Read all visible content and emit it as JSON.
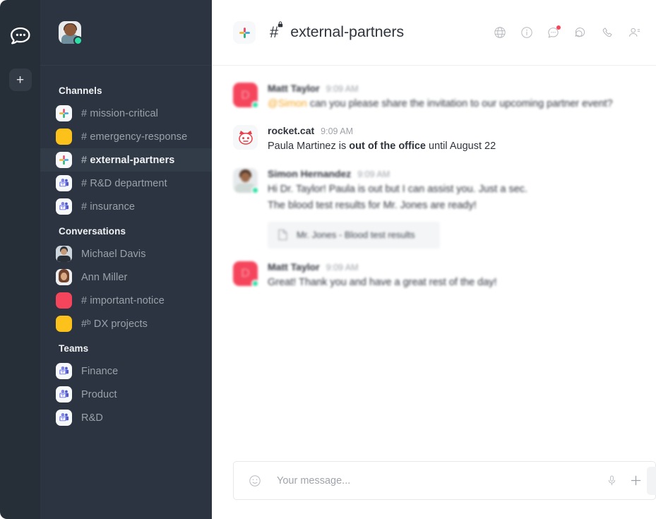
{
  "app": {
    "name": "Rocket.Chat",
    "rail": {
      "logo_icon": "rocket-chat-logo-icon",
      "add_label": "+"
    }
  },
  "sidebar": {
    "user_avatar": {
      "name": "current-user-avatar",
      "status": "online"
    },
    "sections": [
      {
        "title": "Channels",
        "items": [
          {
            "icon": "slack-icon",
            "prefix": "#",
            "label": "mission-critical",
            "active": false
          },
          {
            "icon": "color-swatch-yellow-icon",
            "prefix": "#",
            "label": "emergency-response",
            "active": false
          },
          {
            "icon": "slack-icon",
            "prefix": "#",
            "label": "external-partners",
            "active": true
          },
          {
            "icon": "microsoft-teams-icon",
            "prefix": "#",
            "label": "R&D department",
            "active": false
          },
          {
            "icon": "microsoft-teams-icon",
            "prefix": "#",
            "label": "insurance",
            "active": false
          }
        ]
      },
      {
        "title": "Conversations",
        "items": [
          {
            "icon": "user-avatar-male-icon",
            "prefix": "",
            "label": "Michael Davis",
            "active": false
          },
          {
            "icon": "user-avatar-female-icon",
            "prefix": "",
            "label": "Ann Miller",
            "active": false
          },
          {
            "icon": "color-swatch-red-icon",
            "prefix": "#",
            "label": "important-notice",
            "active": false
          },
          {
            "icon": "color-swatch-yellow-icon",
            "prefix": "#ᵇ",
            "label": "DX projects",
            "active": false
          }
        ]
      },
      {
        "title": "Teams",
        "items": [
          {
            "icon": "microsoft-teams-icon",
            "prefix": "",
            "label": "Finance",
            "active": false
          },
          {
            "icon": "microsoft-teams-icon",
            "prefix": "",
            "label": "Product",
            "active": false
          },
          {
            "icon": "microsoft-teams-icon",
            "prefix": "",
            "label": "R&D",
            "active": false
          }
        ]
      }
    ]
  },
  "header": {
    "channel_icon": "slack-icon",
    "hash": "#",
    "lock_icon": "lock-icon",
    "title": "external-partners",
    "actions": [
      {
        "name": "globe-icon",
        "label": "Globe",
        "badge": false
      },
      {
        "name": "info-circle-icon",
        "label": "Info",
        "badge": false
      },
      {
        "name": "discussion-icon",
        "label": "Discussions",
        "badge": true
      },
      {
        "name": "threads-icon",
        "label": "Threads",
        "badge": false
      },
      {
        "name": "phone-icon",
        "label": "Call",
        "badge": false
      },
      {
        "name": "members-icon",
        "label": "Members",
        "badge": false
      }
    ]
  },
  "messages": [
    {
      "avatar": "letter-avatar-red",
      "avatar_letter": "D",
      "status": "online",
      "name": "Matt Taylor",
      "time": "9:09 AM",
      "mention": "@Simon",
      "text": " can you please share the invitation to our upcoming partner event?",
      "blurred": true
    },
    {
      "avatar": "rocket-cat-avatar",
      "avatar_letter": "",
      "status": "",
      "name": "rocket.cat",
      "time": "9:09 AM",
      "text_pre": "Paula Martinez is ",
      "text_bold": "out of the office",
      "text_post": " until August 22",
      "blurred": false
    },
    {
      "avatar": "photo-avatar",
      "avatar_letter": "",
      "status": "online",
      "name": "Simon Hernandez",
      "time": "9:09 AM",
      "text_line1": "Hi Dr. Taylor! Paula is out but I can assist you. Just a sec.",
      "text_line2": "The blood test results for Mr. Jones are ready!",
      "attachment": {
        "icon": "file-document-icon",
        "name": "Mr. Jones - Blood test results"
      },
      "blurred": true
    },
    {
      "avatar": "letter-avatar-red",
      "avatar_letter": "D",
      "status": "online",
      "name": "Matt Taylor",
      "time": "9:09 AM",
      "text": "Great! Thank you and have a great rest of the day!",
      "blurred": true
    }
  ],
  "composer": {
    "emoji_icon": "emoji-smiley-icon",
    "placeholder": "Your message...",
    "value": "",
    "mic_icon": "microphone-icon",
    "plus_icon": "plus-icon",
    "send_icon": "send-icon"
  },
  "colors": {
    "rail_bg": "#262e38",
    "sidebar_bg": "#2b3440",
    "sidebar_active": "#323c48",
    "accent_red": "#f5455c",
    "accent_yellow": "#fcc21b",
    "status_online": "#2de0a5",
    "text_primary": "#2f343d",
    "text_muted": "#9aa2ab"
  }
}
